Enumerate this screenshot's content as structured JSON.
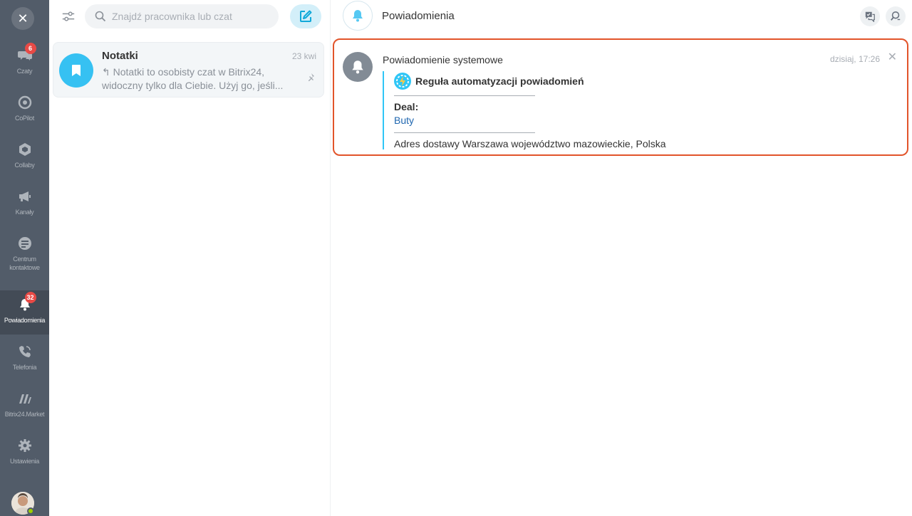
{
  "sidebar": {
    "close_symbol": "✕",
    "items": [
      {
        "label": "Czaty",
        "icon": "chat-bubbles-icon",
        "badge": "6"
      },
      {
        "label": "CoPilot",
        "icon": "copilot-icon",
        "badge": ""
      },
      {
        "label": "Collaby",
        "icon": "collaby-icon",
        "badge": ""
      },
      {
        "label": "Kanały",
        "icon": "megaphone-icon",
        "badge": ""
      },
      {
        "label": "Centrum kontaktowe",
        "icon": "contact-center-icon",
        "badge": ""
      },
      {
        "label": "Powiadomienia",
        "icon": "bell-icon",
        "badge": "32",
        "active": true
      },
      {
        "label": "Telefonia",
        "icon": "phone-icon",
        "badge": ""
      },
      {
        "label": "Bitrix24.Market",
        "icon": "market-icon",
        "badge": ""
      },
      {
        "label": "Ustawienia",
        "icon": "gear-icon",
        "badge": ""
      }
    ]
  },
  "chat_list": {
    "search_placeholder": "Znajdź pracownika lub czat",
    "items": [
      {
        "title": "Notatki",
        "date": "23 kwi",
        "preview": "↰ Notatki to osobisty czat w Bitrix24, widoczny tylko dla Ciebie. Użyj go, jeśli..."
      }
    ]
  },
  "main": {
    "title": "Powiadomienia",
    "notification": {
      "sender": "Powiadomienie systemowe",
      "time": "dzisiaj, 17:26",
      "close_symbol": "✕",
      "rule_title": "Reguła automatyzacji powiadomień",
      "deal_label": "Deal:",
      "deal_link": "Buty",
      "address": "Adres dostawy Warszawa województwo mazowieckie, Polska"
    }
  },
  "colors": {
    "sidebar_bg": "#525c69",
    "accent": "#2fc6f6",
    "badge": "#e84a46",
    "highlight_border": "#e2542a",
    "link": "#2067b0"
  }
}
